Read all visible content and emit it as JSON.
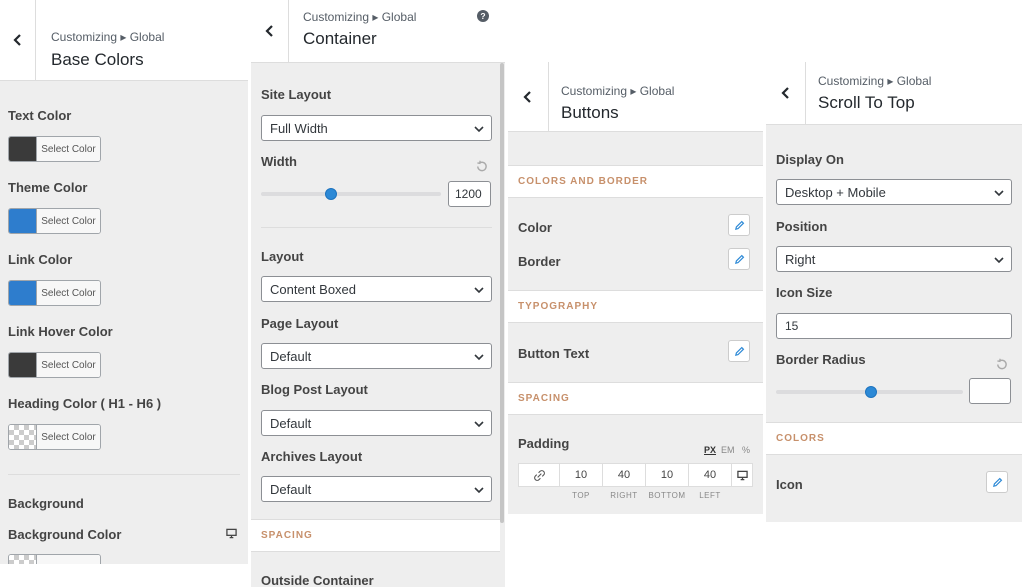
{
  "breadcrumb": "Customizing ▸ Global",
  "base_colors": {
    "title": "Base Colors",
    "select_color_label": "Select Color",
    "colors": [
      {
        "label": "Text Color",
        "value": "#3a3a3a"
      },
      {
        "label": "Theme Color",
        "value": "#2e7dcd"
      },
      {
        "label": "Link Color",
        "value": "#2e7dcd"
      },
      {
        "label": "Link Hover Color",
        "value": "#3a3a3a"
      },
      {
        "label": "Heading Color ( H1 - H6 )",
        "value": "transparent"
      }
    ],
    "background_heading": "Background",
    "background_color_label": "Background Color"
  },
  "container": {
    "title": "Container",
    "site_layout_label": "Site Layout",
    "site_layout_value": "Full Width",
    "width_label": "Width",
    "width_value": "1200",
    "width_slider_fraction": 0.39,
    "layout_label": "Layout",
    "layout_value": "Content Boxed",
    "page_layout_label": "Page Layout",
    "page_layout_value": "Default",
    "blog_post_layout_label": "Blog Post Layout",
    "blog_post_layout_value": "Default",
    "archives_layout_label": "Archives Layout",
    "archives_layout_value": "Default",
    "spacing_section": "SPACING",
    "outside_container_label": "Outside Container"
  },
  "buttons": {
    "title": "Buttons",
    "colors_section": "COLORS AND BORDER",
    "color_label": "Color",
    "border_label": "Border",
    "typography_section": "TYPOGRAPHY",
    "button_text_label": "Button Text",
    "spacing_section": "SPACING",
    "padding_label": "Padding",
    "units": [
      "PX",
      "EM",
      "%"
    ],
    "padding": [
      {
        "value": "10",
        "label": "TOP"
      },
      {
        "value": "40",
        "label": "RIGHT"
      },
      {
        "value": "10",
        "label": "BOTTOM"
      },
      {
        "value": "40",
        "label": "LEFT"
      }
    ]
  },
  "scroll_to_top": {
    "title": "Scroll To Top",
    "display_on_label": "Display On",
    "display_on_value": "Desktop + Mobile",
    "position_label": "Position",
    "position_value": "Right",
    "icon_size_label": "Icon Size",
    "icon_size_value": "15",
    "border_radius_label": "Border Radius",
    "border_radius_value": "",
    "border_radius_slider_fraction": 0.51,
    "colors_section": "COLORS",
    "icon_label": "Icon"
  },
  "icons": {
    "back": "chevron-left-icon",
    "help": "question-circle-icon",
    "reset": "reset-arrow-icon",
    "edit": "pencil-icon",
    "device": "desktop-monitor-icon",
    "link": "unlink-icon",
    "dropdown": "chevron-down-icon"
  },
  "colors": {
    "accent": "#2c89d6",
    "section_heading": "#c7906b",
    "panel_bg": "#eeeeee"
  }
}
